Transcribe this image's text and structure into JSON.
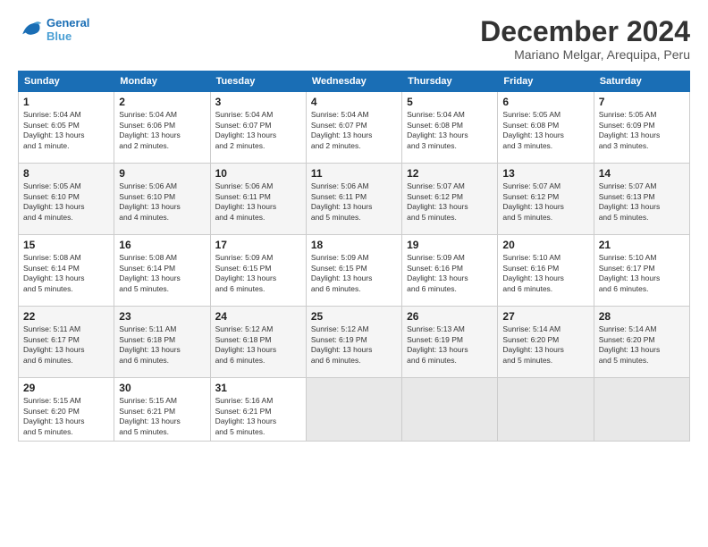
{
  "header": {
    "logo_line1": "General",
    "logo_line2": "Blue",
    "month": "December 2024",
    "location": "Mariano Melgar, Arequipa, Peru"
  },
  "weekdays": [
    "Sunday",
    "Monday",
    "Tuesday",
    "Wednesday",
    "Thursday",
    "Friday",
    "Saturday"
  ],
  "weeks": [
    [
      {
        "day": "1",
        "info": "Sunrise: 5:04 AM\nSunset: 6:05 PM\nDaylight: 13 hours\nand 1 minute."
      },
      {
        "day": "2",
        "info": "Sunrise: 5:04 AM\nSunset: 6:06 PM\nDaylight: 13 hours\nand 2 minutes."
      },
      {
        "day": "3",
        "info": "Sunrise: 5:04 AM\nSunset: 6:07 PM\nDaylight: 13 hours\nand 2 minutes."
      },
      {
        "day": "4",
        "info": "Sunrise: 5:04 AM\nSunset: 6:07 PM\nDaylight: 13 hours\nand 2 minutes."
      },
      {
        "day": "5",
        "info": "Sunrise: 5:04 AM\nSunset: 6:08 PM\nDaylight: 13 hours\nand 3 minutes."
      },
      {
        "day": "6",
        "info": "Sunrise: 5:05 AM\nSunset: 6:08 PM\nDaylight: 13 hours\nand 3 minutes."
      },
      {
        "day": "7",
        "info": "Sunrise: 5:05 AM\nSunset: 6:09 PM\nDaylight: 13 hours\nand 3 minutes."
      }
    ],
    [
      {
        "day": "8",
        "info": "Sunrise: 5:05 AM\nSunset: 6:10 PM\nDaylight: 13 hours\nand 4 minutes."
      },
      {
        "day": "9",
        "info": "Sunrise: 5:06 AM\nSunset: 6:10 PM\nDaylight: 13 hours\nand 4 minutes."
      },
      {
        "day": "10",
        "info": "Sunrise: 5:06 AM\nSunset: 6:11 PM\nDaylight: 13 hours\nand 4 minutes."
      },
      {
        "day": "11",
        "info": "Sunrise: 5:06 AM\nSunset: 6:11 PM\nDaylight: 13 hours\nand 5 minutes."
      },
      {
        "day": "12",
        "info": "Sunrise: 5:07 AM\nSunset: 6:12 PM\nDaylight: 13 hours\nand 5 minutes."
      },
      {
        "day": "13",
        "info": "Sunrise: 5:07 AM\nSunset: 6:12 PM\nDaylight: 13 hours\nand 5 minutes."
      },
      {
        "day": "14",
        "info": "Sunrise: 5:07 AM\nSunset: 6:13 PM\nDaylight: 13 hours\nand 5 minutes."
      }
    ],
    [
      {
        "day": "15",
        "info": "Sunrise: 5:08 AM\nSunset: 6:14 PM\nDaylight: 13 hours\nand 5 minutes."
      },
      {
        "day": "16",
        "info": "Sunrise: 5:08 AM\nSunset: 6:14 PM\nDaylight: 13 hours\nand 5 minutes."
      },
      {
        "day": "17",
        "info": "Sunrise: 5:09 AM\nSunset: 6:15 PM\nDaylight: 13 hours\nand 6 minutes."
      },
      {
        "day": "18",
        "info": "Sunrise: 5:09 AM\nSunset: 6:15 PM\nDaylight: 13 hours\nand 6 minutes."
      },
      {
        "day": "19",
        "info": "Sunrise: 5:09 AM\nSunset: 6:16 PM\nDaylight: 13 hours\nand 6 minutes."
      },
      {
        "day": "20",
        "info": "Sunrise: 5:10 AM\nSunset: 6:16 PM\nDaylight: 13 hours\nand 6 minutes."
      },
      {
        "day": "21",
        "info": "Sunrise: 5:10 AM\nSunset: 6:17 PM\nDaylight: 13 hours\nand 6 minutes."
      }
    ],
    [
      {
        "day": "22",
        "info": "Sunrise: 5:11 AM\nSunset: 6:17 PM\nDaylight: 13 hours\nand 6 minutes."
      },
      {
        "day": "23",
        "info": "Sunrise: 5:11 AM\nSunset: 6:18 PM\nDaylight: 13 hours\nand 6 minutes."
      },
      {
        "day": "24",
        "info": "Sunrise: 5:12 AM\nSunset: 6:18 PM\nDaylight: 13 hours\nand 6 minutes."
      },
      {
        "day": "25",
        "info": "Sunrise: 5:12 AM\nSunset: 6:19 PM\nDaylight: 13 hours\nand 6 minutes."
      },
      {
        "day": "26",
        "info": "Sunrise: 5:13 AM\nSunset: 6:19 PM\nDaylight: 13 hours\nand 6 minutes."
      },
      {
        "day": "27",
        "info": "Sunrise: 5:14 AM\nSunset: 6:20 PM\nDaylight: 13 hours\nand 5 minutes."
      },
      {
        "day": "28",
        "info": "Sunrise: 5:14 AM\nSunset: 6:20 PM\nDaylight: 13 hours\nand 5 minutes."
      }
    ],
    [
      {
        "day": "29",
        "info": "Sunrise: 5:15 AM\nSunset: 6:20 PM\nDaylight: 13 hours\nand 5 minutes."
      },
      {
        "day": "30",
        "info": "Sunrise: 5:15 AM\nSunset: 6:21 PM\nDaylight: 13 hours\nand 5 minutes."
      },
      {
        "day": "31",
        "info": "Sunrise: 5:16 AM\nSunset: 6:21 PM\nDaylight: 13 hours\nand 5 minutes."
      },
      {
        "day": "",
        "info": ""
      },
      {
        "day": "",
        "info": ""
      },
      {
        "day": "",
        "info": ""
      },
      {
        "day": "",
        "info": ""
      }
    ]
  ]
}
